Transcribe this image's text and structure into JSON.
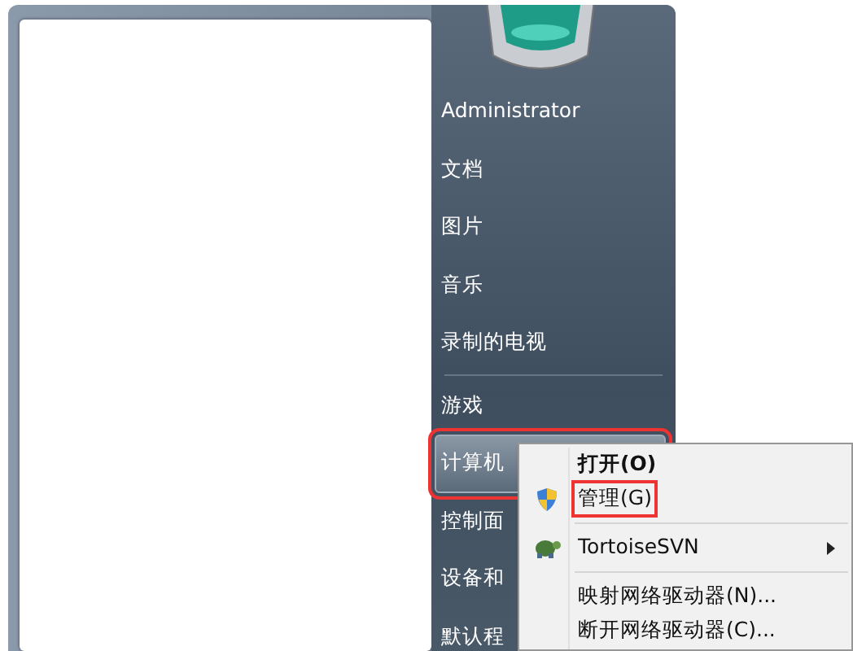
{
  "start_menu": {
    "place_groups": [
      {
        "items": [
          {
            "label": "Administrator",
            "selected": false,
            "annotated": false
          },
          {
            "label": "文档",
            "selected": false,
            "annotated": false
          },
          {
            "label": "图片",
            "selected": false,
            "annotated": false
          },
          {
            "label": "音乐",
            "selected": false,
            "annotated": false
          },
          {
            "label": "录制的电视",
            "selected": false,
            "annotated": false
          }
        ]
      },
      {
        "items": [
          {
            "label": "游戏",
            "selected": false,
            "annotated": false
          },
          {
            "label": "计算机",
            "selected": true,
            "annotated": true
          },
          {
            "label": "控制面",
            "selected": false,
            "annotated": false
          },
          {
            "label": "设备和",
            "selected": false,
            "annotated": false
          },
          {
            "label": "默认程",
            "selected": false,
            "annotated": false
          }
        ]
      }
    ]
  },
  "context_menu": {
    "groups": [
      {
        "items": [
          {
            "label": "打开(O)",
            "default": true,
            "kind": "plain",
            "submenu": false,
            "annotated": false
          },
          {
            "label": "管理(G)",
            "default": false,
            "kind": "shield",
            "submenu": false,
            "annotated": true
          }
        ]
      },
      {
        "items": [
          {
            "label": "TortoiseSVN",
            "default": false,
            "kind": "turtle",
            "submenu": true,
            "annotated": false
          }
        ]
      },
      {
        "items": [
          {
            "label": "映射网络驱动器(N)...",
            "default": false,
            "kind": "plain",
            "submenu": false,
            "annotated": false
          },
          {
            "label": "断开网络驱动器(C)...",
            "default": false,
            "kind": "plain",
            "submenu": false,
            "annotated": false
          }
        ]
      }
    ]
  }
}
